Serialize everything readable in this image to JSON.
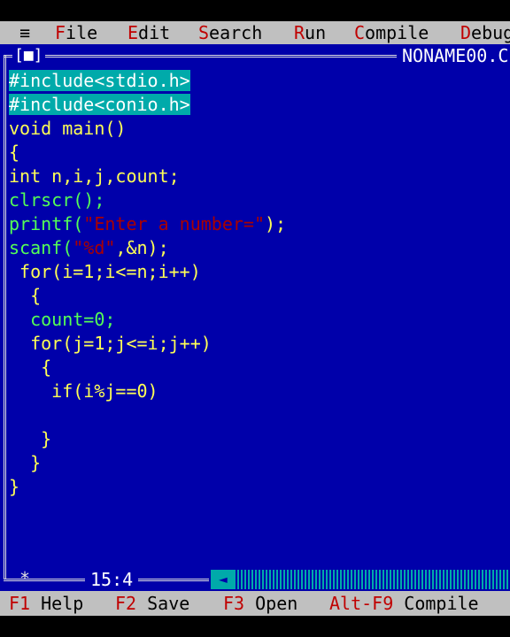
{
  "menu": {
    "system": "≡",
    "items": [
      {
        "hot": "F",
        "rest": "ile"
      },
      {
        "hot": "E",
        "rest": "dit"
      },
      {
        "hot": "S",
        "rest": "earch"
      },
      {
        "hot": "R",
        "rest": "un"
      },
      {
        "hot": "C",
        "rest": "ompile"
      },
      {
        "hot": "D",
        "rest": "ebug"
      }
    ]
  },
  "window": {
    "close": "[■]",
    "filename": "NONAME00.C"
  },
  "code": {
    "l1": "#include<stdio.h>",
    "l2": "#include<conio.h>",
    "l3": "void main()",
    "l4": "{",
    "l5": "int n,i,j,count;",
    "l6": "clrscr();",
    "l7a": "printf(",
    "l7b": "\"Enter a number=\"",
    "l7c": ");",
    "l8a": "scanf(",
    "l8b": "\"%d\"",
    "l8c": ",&n);",
    "l9": " for(i=1;i<=n;i++)",
    "l10": "  {",
    "l11": "  count=0;",
    "l12": "  for(j=1;j<=i;j++)",
    "l13": "   {",
    "l14": "    if(i%j==0)",
    "l15": "",
    "l16": "   }",
    "l17": "  }",
    "l18": "}"
  },
  "status": {
    "marker": "*",
    "position": "15:4",
    "scroll_left": "◄"
  },
  "fkeys": [
    {
      "key": "F1",
      "label": "Help"
    },
    {
      "key": "F2",
      "label": "Save"
    },
    {
      "key": "F3",
      "label": "Open"
    },
    {
      "key": "Alt-F9",
      "label": "Compile"
    }
  ]
}
